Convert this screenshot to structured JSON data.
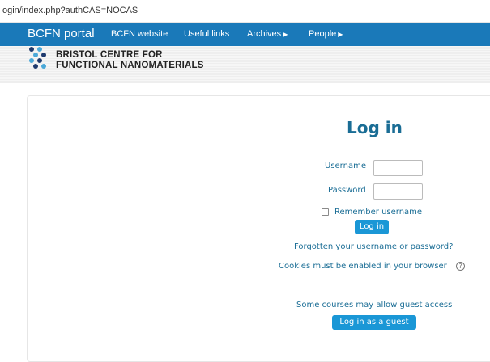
{
  "browser": {
    "url": "ogin/index.php?authCAS=NOCAS"
  },
  "navbar": {
    "brand": "BCFN portal",
    "links": [
      {
        "label": "BCFN website"
      },
      {
        "label": "Useful links"
      },
      {
        "label": "Archives"
      },
      {
        "label": "People"
      }
    ],
    "background_color": "#1a79b9"
  },
  "logo": {
    "line1": "BRISTOL CENTRE FOR",
    "line2": "FUNCTIONAL NANOMATERIALS"
  },
  "login": {
    "title": "Log in",
    "username_label": "Username",
    "password_label": "Password",
    "remember_label": "Remember username",
    "login_button": "Log in",
    "forgot_link": "Forgotten your username or password?",
    "cookies_text": "Cookies must be enabled in your browser",
    "guest_text": "Some courses may allow guest access",
    "guest_button": "Log in as a guest",
    "accent_color": "#1a6d95",
    "button_color": "#1a97d6"
  }
}
